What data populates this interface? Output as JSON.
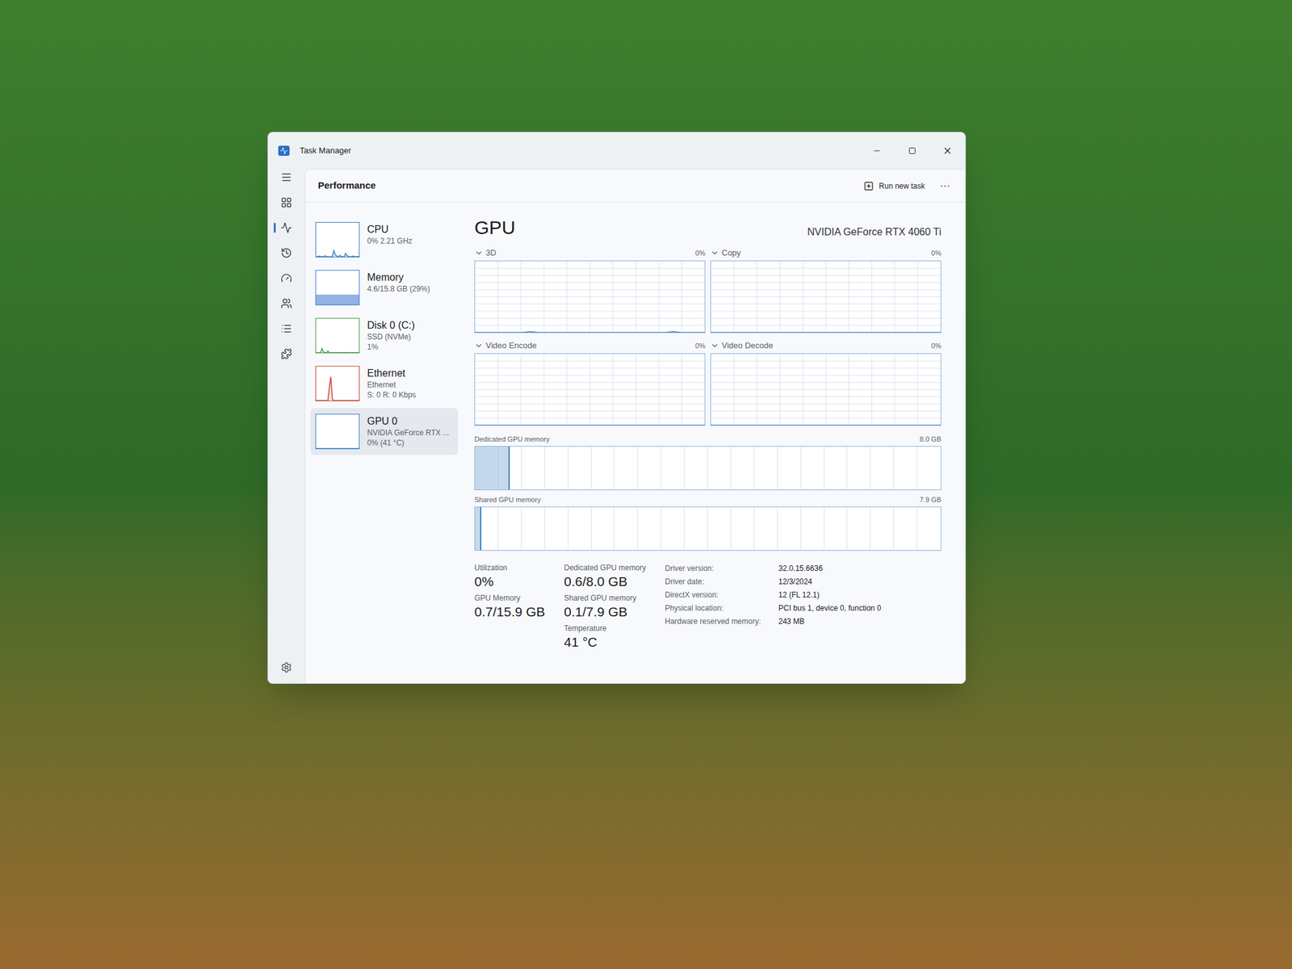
{
  "window": {
    "title": "Task Manager"
  },
  "header": {
    "title": "Performance",
    "run_new_task": "Run new task",
    "more": "···"
  },
  "sidebar": {
    "items": [
      {
        "name": "CPU",
        "details": [
          "0% 2.21 GHz"
        ],
        "selected": false,
        "kind": "line",
        "color": "#3b82c4",
        "values": [
          0,
          0,
          2,
          1,
          0,
          0,
          3,
          1,
          0,
          0,
          0,
          1,
          18,
          6,
          2,
          0,
          4,
          1,
          0,
          0,
          10,
          3,
          1,
          0,
          0,
          2,
          0,
          0,
          1,
          0
        ]
      },
      {
        "name": "Memory",
        "details": [
          "4.6/15.8 GB (29%)"
        ],
        "selected": false,
        "kind": "fill",
        "color": "#4a7fd6",
        "level": 0.29
      },
      {
        "name": "Disk 0 (C:)",
        "details": [
          "SSD (NVMe)",
          "1%"
        ],
        "selected": false,
        "kind": "line",
        "color": "#4e9a52",
        "values": [
          0,
          0,
          0,
          0,
          12,
          2,
          0,
          0,
          5,
          0,
          0,
          0,
          0,
          0,
          0,
          0,
          0,
          0,
          0,
          1,
          0,
          0,
          0,
          0,
          0,
          0,
          0,
          0,
          0,
          0
        ]
      },
      {
        "name": "Ethernet",
        "details": [
          "Ethernet",
          "S: 0 R: 0 Kbps"
        ],
        "selected": false,
        "kind": "line",
        "color": "#c8483c",
        "values": [
          0,
          0,
          0,
          0,
          0,
          0,
          0,
          0,
          0,
          40,
          70,
          5,
          0,
          0,
          0,
          0,
          0,
          0,
          0,
          0,
          0,
          0,
          0,
          0,
          0,
          0,
          0,
          0,
          0,
          0
        ]
      },
      {
        "name": "GPU 0",
        "details": [
          "NVIDIA GeForce RTX ...",
          "0% (41 °C)"
        ],
        "selected": true,
        "kind": "line",
        "color": "#3b82c4",
        "values": [
          0,
          0,
          0,
          0,
          0,
          0,
          0,
          0,
          0,
          0,
          0,
          0,
          0,
          0,
          0,
          0,
          0,
          0,
          0,
          0,
          0,
          0,
          0,
          0,
          0,
          0,
          0,
          0,
          0,
          0
        ]
      }
    ]
  },
  "gpu": {
    "title": "GPU",
    "model": "NVIDIA GeForce RTX 4060 Ti",
    "engines": [
      {
        "label": "3D",
        "reading": "0%",
        "values": [
          0,
          0,
          0,
          0,
          0,
          0,
          0,
          1,
          0,
          0,
          0,
          0,
          0,
          0,
          0,
          0,
          0,
          0,
          0,
          0,
          0,
          0,
          0,
          0,
          0,
          1,
          0,
          0,
          0,
          0
        ]
      },
      {
        "label": "Copy",
        "reading": "0%",
        "values": [
          0,
          0,
          0,
          0,
          0,
          0,
          0,
          0,
          0,
          0,
          0,
          0,
          0,
          0,
          0,
          0,
          0,
          0,
          0,
          0,
          0,
          0,
          0,
          0,
          0,
          0,
          0,
          0,
          0,
          0
        ]
      },
      {
        "label": "Video Encode",
        "reading": "0%",
        "values": [
          0,
          0,
          0,
          0,
          0,
          0,
          0,
          0,
          0,
          0,
          0,
          0,
          0,
          0,
          0,
          0,
          0,
          0,
          0,
          0,
          0,
          0,
          0,
          0,
          0,
          0,
          0,
          0,
          0,
          0
        ]
      },
      {
        "label": "Video Decode",
        "reading": "0%",
        "values": [
          0,
          0,
          0,
          0,
          0,
          0,
          0,
          0,
          0,
          0,
          0,
          0,
          0,
          0,
          0,
          0,
          0,
          0,
          0,
          0,
          0,
          0,
          0,
          0,
          0,
          0,
          0,
          0,
          0,
          0
        ]
      }
    ],
    "memory_charts": [
      {
        "label": "Dedicated GPU memory",
        "max": "8.0 GB",
        "level": 0.075
      },
      {
        "label": "Shared GPU memory",
        "max": "7.9 GB",
        "level": 0.013
      }
    ],
    "stat_columns": [
      [
        {
          "label": "Utilization",
          "value": "0%"
        },
        {
          "label": "GPU Memory",
          "value": "0.7/15.9 GB"
        }
      ],
      [
        {
          "label": "Dedicated GPU memory",
          "value": "0.6/8.0 GB"
        },
        {
          "label": "Shared GPU memory",
          "value": "0.1/7.9 GB"
        },
        {
          "label": "Temperature",
          "value": "41 °C"
        }
      ]
    ],
    "properties": [
      {
        "label": "Driver version:",
        "value": "32.0.15.6636"
      },
      {
        "label": "Driver date:",
        "value": "12/3/2024"
      },
      {
        "label": "DirectX version:",
        "value": "12 (FL 12.1)"
      },
      {
        "label": "Physical location:",
        "value": "PCI bus 1, device 0, function 0"
      },
      {
        "label": "Hardware reserved memory:",
        "value": "243 MB"
      }
    ]
  }
}
